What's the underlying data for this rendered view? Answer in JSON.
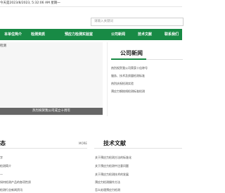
{
  "topbar": {
    "text": "今天是2023/8/2023, 5:32:06 AM 星期一"
  },
  "search": {
    "placeholder": "请输入关键词"
  },
  "nav": {
    "items": [
      "本单位简介",
      "检测资质",
      "预应力检测实验室",
      "公司新闻",
      "技术文献",
      "联系我们"
    ]
  },
  "banner": {
    "tag": "检测",
    "caption": "热烈祝贺我公司成立十周年"
  },
  "company_news": {
    "title": "公司新闻",
    "items": [
      "热烈祝贺我公司荣获十佳称号",
      "服务、技术及质量检测标准",
      "热烈庆祝检测实验",
      "预应力钢绞线检测标准检测"
    ]
  },
  "left_section": {
    "title": "态",
    "more": "MORE",
    "items": [
      "字",
      "检测简介",
      "—",
      "如何检测产品的各项性质",
      "检测行业新闻资讯"
    ]
  },
  "tech_docs": {
    "title": "技术文献",
    "items": [
      "关于预应力检测方法的标准化",
      "关于预应力检测中注意问题",
      "关于预应力检测技术的发展",
      "预应力检测操作方法",
      "怎么处理预应力检测"
    ]
  }
}
